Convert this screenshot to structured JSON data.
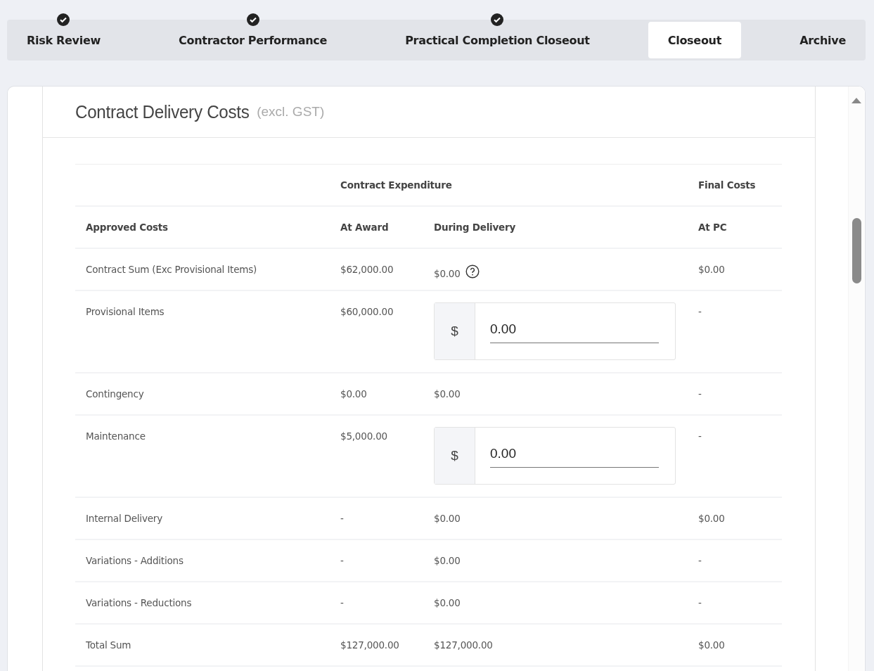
{
  "tabs": [
    {
      "label": "Risk Review",
      "completed": true,
      "selected": false
    },
    {
      "label": "Contractor Performance",
      "completed": true,
      "selected": false
    },
    {
      "label": "Practical Completion Closeout",
      "completed": true,
      "selected": false
    },
    {
      "label": "Closeout",
      "completed": false,
      "selected": true
    },
    {
      "label": "Archive",
      "completed": false,
      "selected": false
    }
  ],
  "section": {
    "title": "Contract Delivery Costs",
    "note": "(excl. GST)"
  },
  "table": {
    "group_headers": {
      "expenditure": "Contract Expenditure",
      "final": "Final Costs"
    },
    "columns": [
      "Approved Costs",
      "At Award",
      "During Delivery",
      "At PC"
    ],
    "rows": [
      {
        "label": "Contract Sum (Exc Provisional Items)",
        "at_award": "$62,000.00",
        "during_delivery": {
          "kind": "text",
          "value": "$0.00",
          "help": true
        },
        "at_pc": "$0.00"
      },
      {
        "label": "Provisional Items",
        "at_award": "$60,000.00",
        "during_delivery": {
          "kind": "input",
          "prefix": "$",
          "value": "0.00"
        },
        "at_pc": "-"
      },
      {
        "label": "Contingency",
        "at_award": "$0.00",
        "during_delivery": {
          "kind": "text",
          "value": "$0.00",
          "help": false
        },
        "at_pc": "-"
      },
      {
        "label": "Maintenance",
        "at_award": "$5,000.00",
        "during_delivery": {
          "kind": "input",
          "prefix": "$",
          "value": "0.00"
        },
        "at_pc": "-"
      },
      {
        "label": "Internal Delivery",
        "at_award": "-",
        "during_delivery": {
          "kind": "text",
          "value": "$0.00",
          "help": false
        },
        "at_pc": "$0.00"
      },
      {
        "label": "Variations - Additions",
        "at_award": "-",
        "during_delivery": {
          "kind": "text",
          "value": "$0.00",
          "help": false
        },
        "at_pc": "-"
      },
      {
        "label": "Variations - Reductions",
        "at_award": "-",
        "during_delivery": {
          "kind": "text",
          "value": "$0.00",
          "help": false
        },
        "at_pc": "-"
      },
      {
        "label": "Total Sum",
        "at_award": "$127,000.00",
        "during_delivery": {
          "kind": "text",
          "value": "$127,000.00",
          "help": false
        },
        "at_pc": "$0.00"
      }
    ]
  }
}
